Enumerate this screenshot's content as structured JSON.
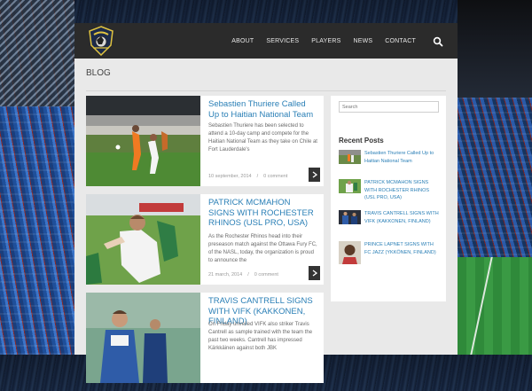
{
  "nav": {
    "items": [
      "ABOUT",
      "SERVICES",
      "PLAYERS",
      "NEWS",
      "CONTACT"
    ],
    "search_icon": "search-icon"
  },
  "page": {
    "title": "BLOG"
  },
  "posts": [
    {
      "title": "Sebastien Thuriere Called Up to Haitian National Team",
      "excerpt": "Sebastien Thuriere has been selected to attend a 10-day camp and compete for the Haitian National Team as they take on Chile at Fort Lauderdale's",
      "date": "10 september, 2014",
      "comments": "0 comment"
    },
    {
      "title": "PATRICK MCMAHON SIGNS WITH ROCHESTER RHINOS (USL PRO, USA)",
      "excerpt": "As the Rochester Rhinos head into their preseason match against the Ottawa Fury FC, of the NASL, today, the organization is proud to announce the",
      "date": "21 march, 2014",
      "comments": "0 comment"
    },
    {
      "title": "TRAVIS CANTRELL SIGNS WITH VIFK (KAKKONEN, FINLAND)",
      "excerpt": "On Friday unveiled VIFK also striker Travis Cantrell as sample trained with the team the past two weeks. Cantrell has impressed Kärkkäinen against both JBK",
      "date": "",
      "comments": ""
    }
  ],
  "sidebar": {
    "search_placeholder": "Search",
    "recent_title": "Recent Posts",
    "recent": [
      "Sebastien Thuriere Called Up to Haitian National Team",
      "PATRICK MCMAHON SIGNS WITH ROCHESTER RHINOS (USL PRO, USA)",
      "TRAVIS CANTRELL SIGNS WITH VIFK (KAKKONEN, FINLAND)",
      "PRINCE LAPNET SIGNS WITH FC JAZZ (YKKÖNEN, FINLAND)"
    ]
  },
  "colors": {
    "header_bg": "#2b2b2b",
    "link_blue": "#2a7fb6",
    "page_bg": "#e9e9e9"
  }
}
